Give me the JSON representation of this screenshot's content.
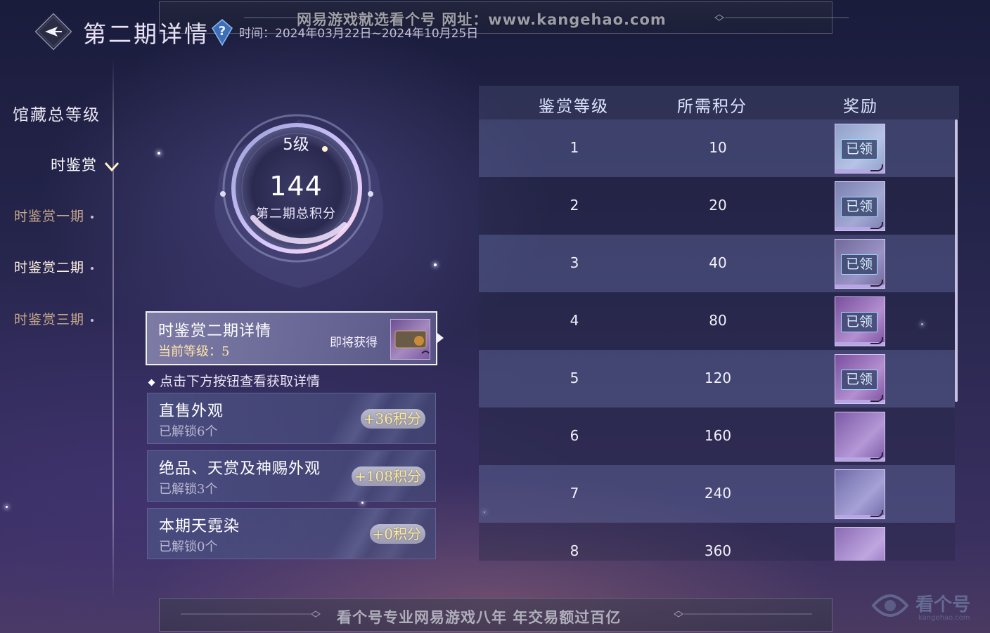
{
  "watermark_top": "网易游戏就选看个号   网址：www.kangehao.com",
  "watermark_bottom": "看个号专业网易游戏八年   年交易额过百亿",
  "header": {
    "title": "第二期详情",
    "time": "时间：2024年03月22日~2024年10月25日"
  },
  "nav": {
    "main": "馆藏总等级",
    "active_group": "时鉴赏",
    "items": [
      {
        "label": "时鉴赏一期",
        "state": "dim"
      },
      {
        "label": "时鉴赏二期",
        "state": "active"
      },
      {
        "label": "时鉴赏三期",
        "state": "dim"
      }
    ]
  },
  "emblem": {
    "level": "5级",
    "score": "144",
    "label": "第二期总积分"
  },
  "detail": {
    "title": "时鉴赏二期详情",
    "level": "当前等级：5",
    "soon": "即将获得"
  },
  "hint": "点击下方按钮查看获取详情",
  "categories": [
    {
      "title": "直售外观",
      "sub": "已解锁6个",
      "points": "+36积分"
    },
    {
      "title": "绝品、天赏及神赐外观",
      "sub": "已解锁3个",
      "points": "+108积分"
    },
    {
      "title": "本期天霓染",
      "sub": "已解锁0个",
      "points": "+0积分"
    }
  ],
  "table": {
    "headers": [
      "鉴赏等级",
      "所需积分",
      "奖励"
    ],
    "rows": [
      {
        "level": "1",
        "points": "10",
        "status": "已领",
        "reward_icon": "gem-reward-icon"
      },
      {
        "level": "2",
        "points": "20",
        "status": "已领",
        "reward_icon": "pet-reward-icon"
      },
      {
        "level": "3",
        "points": "40",
        "status": "已领",
        "reward_icon": "ring-reward-icon"
      },
      {
        "level": "4",
        "points": "80",
        "status": "已领",
        "reward_icon": "card-reward-icon"
      },
      {
        "level": "5",
        "points": "120",
        "status": "已领",
        "reward_icon": "card-reward-icon"
      },
      {
        "level": "6",
        "points": "160",
        "status": "",
        "reward_icon": "scroll-reward-icon"
      },
      {
        "level": "7",
        "points": "240",
        "status": "",
        "reward_icon": "couple-reward-icon"
      },
      {
        "level": "8",
        "points": "360",
        "status": "",
        "reward_icon": "frame-reward-icon"
      }
    ]
  },
  "logo": {
    "name": "看个号",
    "domain": "kangehao.com"
  },
  "colors": {
    "accent": "#ffe2a8",
    "claimed_border": "#9ad8ff",
    "points_text": "#fbe9a0"
  }
}
